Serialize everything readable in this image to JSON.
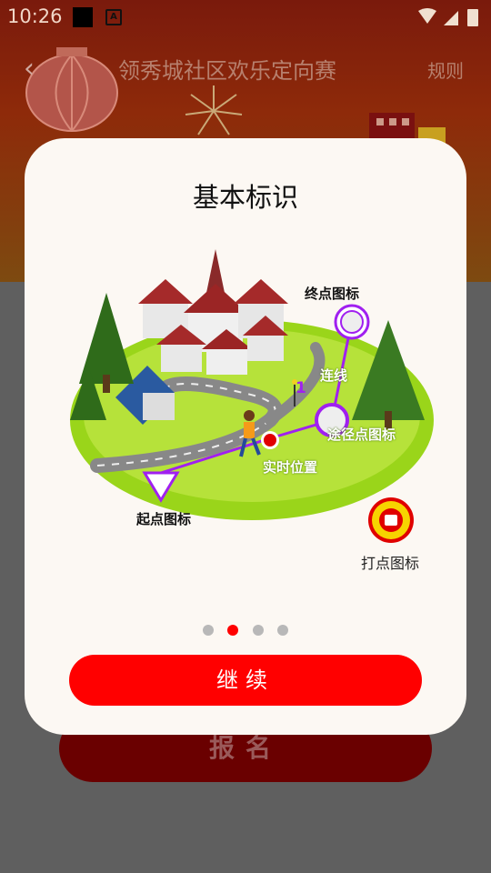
{
  "status_bar": {
    "time": "10:26",
    "notification_letter": "A"
  },
  "header": {
    "title": "领秀城社区欢乐定向赛",
    "rules_label": "规则",
    "back_icon": "chevron-left-icon"
  },
  "background": {
    "signup_label": "报名"
  },
  "modal": {
    "title": "基本标识",
    "labels": {
      "finish": "终点图标",
      "line": "连线",
      "waypoint": "途径点图标",
      "realtime": "实时位置",
      "start": "起点图标",
      "checkin": "打点图标",
      "waypoint_number": "1"
    },
    "pagination": {
      "count": 4,
      "active_index": 1
    },
    "continue_label": "继续"
  },
  "colors": {
    "accent": "#ff0000",
    "route": "#a020f0",
    "grass": "#8fd400"
  }
}
